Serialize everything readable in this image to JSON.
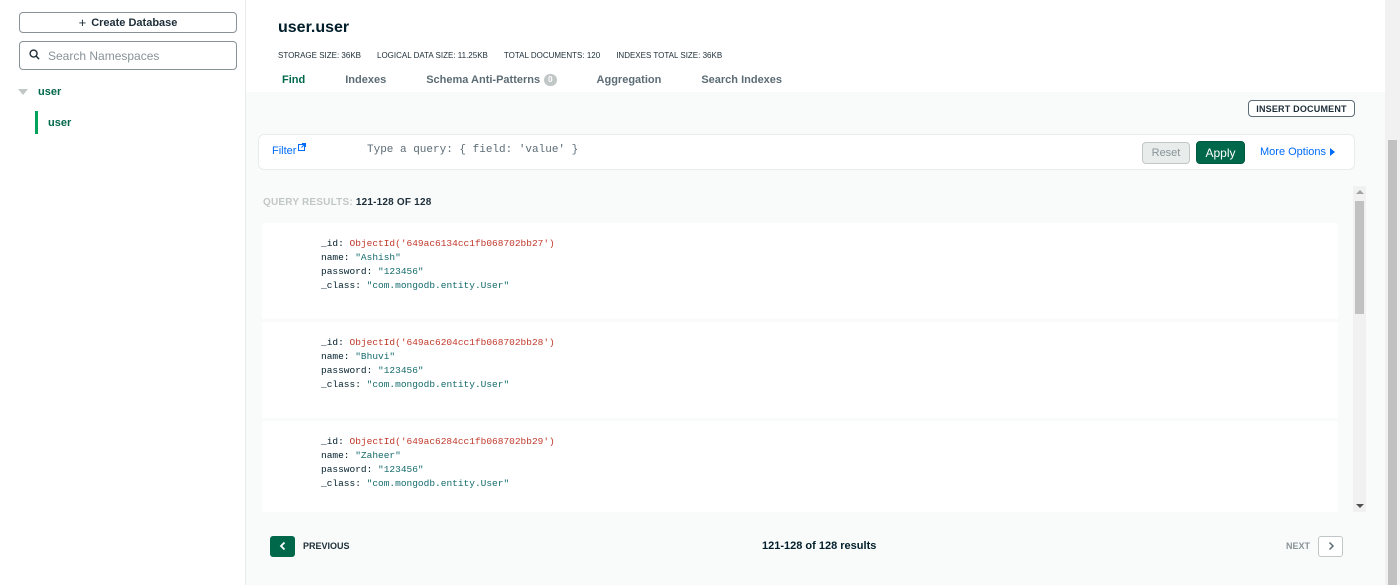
{
  "sidebar": {
    "create_database": "Create Database",
    "search_placeholder": "Search Namespaces",
    "database": "user",
    "collection": "user"
  },
  "header": {
    "title": "user.user",
    "stats": {
      "storage_size": "STORAGE SIZE: 36KB",
      "logical_size": "LOGICAL DATA SIZE: 11.25KB",
      "total_documents": "TOTAL DOCUMENTS: 120",
      "indexes_size": "INDEXES TOTAL SIZE: 36KB"
    },
    "tabs": [
      {
        "label": "Find",
        "active": true
      },
      {
        "label": "Indexes"
      },
      {
        "label": "Schema Anti-Patterns",
        "badge": "0"
      },
      {
        "label": "Aggregation"
      },
      {
        "label": "Search Indexes"
      }
    ]
  },
  "toolbar": {
    "insert_document": "INSERT DOCUMENT",
    "filter_label": "Filter",
    "query_placeholder": "Type a query: { field: 'value' }",
    "reset": "Reset",
    "apply": "Apply",
    "more_options": "More Options"
  },
  "results": {
    "label": "QUERY RESULTS:",
    "range": "121-128 OF 128"
  },
  "documents": [
    {
      "id_key": "_id:",
      "id": "ObjectId('649ac6134cc1fb068702bb27')",
      "name_key": "name:",
      "name": "\"Ashish\"",
      "password_key": "password:",
      "password": "\"123456\"",
      "class_key": "_class:",
      "class": "\"com.mongodb.entity.User\""
    },
    {
      "id_key": "_id:",
      "id": "ObjectId('649ac6204cc1fb068702bb28')",
      "name_key": "name:",
      "name": "\"Bhuvi\"",
      "password_key": "password:",
      "password": "\"123456\"",
      "class_key": "_class:",
      "class": "\"com.mongodb.entity.User\""
    },
    {
      "id_key": "_id:",
      "id": "ObjectId('649ac6284cc1fb068702bb29')",
      "name_key": "name:",
      "name": "\"Zaheer\"",
      "password_key": "password:",
      "password": "\"123456\"",
      "class_key": "_class:",
      "class": "\"com.mongodb.entity.User\""
    }
  ],
  "pagination": {
    "previous": "PREVIOUS",
    "count": "121-128 of 128 results",
    "next": "NEXT"
  },
  "colors": {
    "accent_green": "#00684a",
    "link_blue": "#016bf8",
    "objectid_red": "#c0392b",
    "string_teal": "#146a6c"
  }
}
